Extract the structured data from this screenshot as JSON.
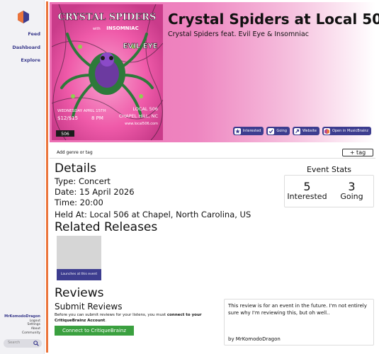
{
  "sidebar": {
    "nav": [
      "Feed",
      "Dashboard",
      "Explore"
    ],
    "user": "MrKomodoDragon",
    "links": [
      "Logout",
      "Settings",
      "About",
      "Community"
    ],
    "search_placeholder": "Search"
  },
  "poster": {
    "band": "CRYSTAL SPIDERS",
    "with": "with",
    "support1": "INSOMNIAC",
    "support2": "EVIL EYE",
    "date": "WEDNESDAY APRIL 15TH",
    "price": "$12/$15",
    "time": "8 PM",
    "venue": "LOCAL 506",
    "city": "CHAPEL HILL, NC",
    "site": "www.local506.com",
    "logo": "506"
  },
  "event": {
    "title": "Crystal Spiders at Local 506",
    "subtitle": "Crystal Spiders feat. Evil Eye & Insomniac"
  },
  "actions": {
    "interested": "Interested",
    "going": "Going",
    "website": "Website",
    "musicbrainz": "Open in MusicBrainz"
  },
  "tags": {
    "placeholder": "Add genre or tag",
    "add_label": "+ tag"
  },
  "details": {
    "heading": "Details",
    "type": "Type: Concert",
    "date": "Date: 15 April 2026",
    "time": "Time: 20:00",
    "held_at": "Held At: Local 506 at Chapel, North Carolina, US"
  },
  "stats": {
    "title": "Event Stats",
    "interested_count": "5",
    "interested_label": "Interested",
    "going_count": "3",
    "going_label": "Going"
  },
  "related": {
    "heading": "Related Releases",
    "items": [
      {
        "label": "Launches at this event"
      }
    ]
  },
  "reviews": {
    "heading": "Reviews",
    "submit_heading": "Submit Reviews",
    "submit_text_1": "Before you can submit reviews for your listens, you must ",
    "submit_text_bold": "connect to your CritiqueBrainz Account",
    "submit_text_2": ".",
    "connect_button": "Connect to CritiqueBrainz",
    "items": [
      {
        "text": "This review is for an event in the future. I'm not entirely sure why I'm reviewing this, but oh well..",
        "author": "by MrKomodoDragon"
      }
    ]
  },
  "colors": {
    "accent": "#eb743b",
    "primary": "#3d3d8f",
    "connect": "#3aa03f",
    "hero_pink": "#ec6fb4"
  }
}
